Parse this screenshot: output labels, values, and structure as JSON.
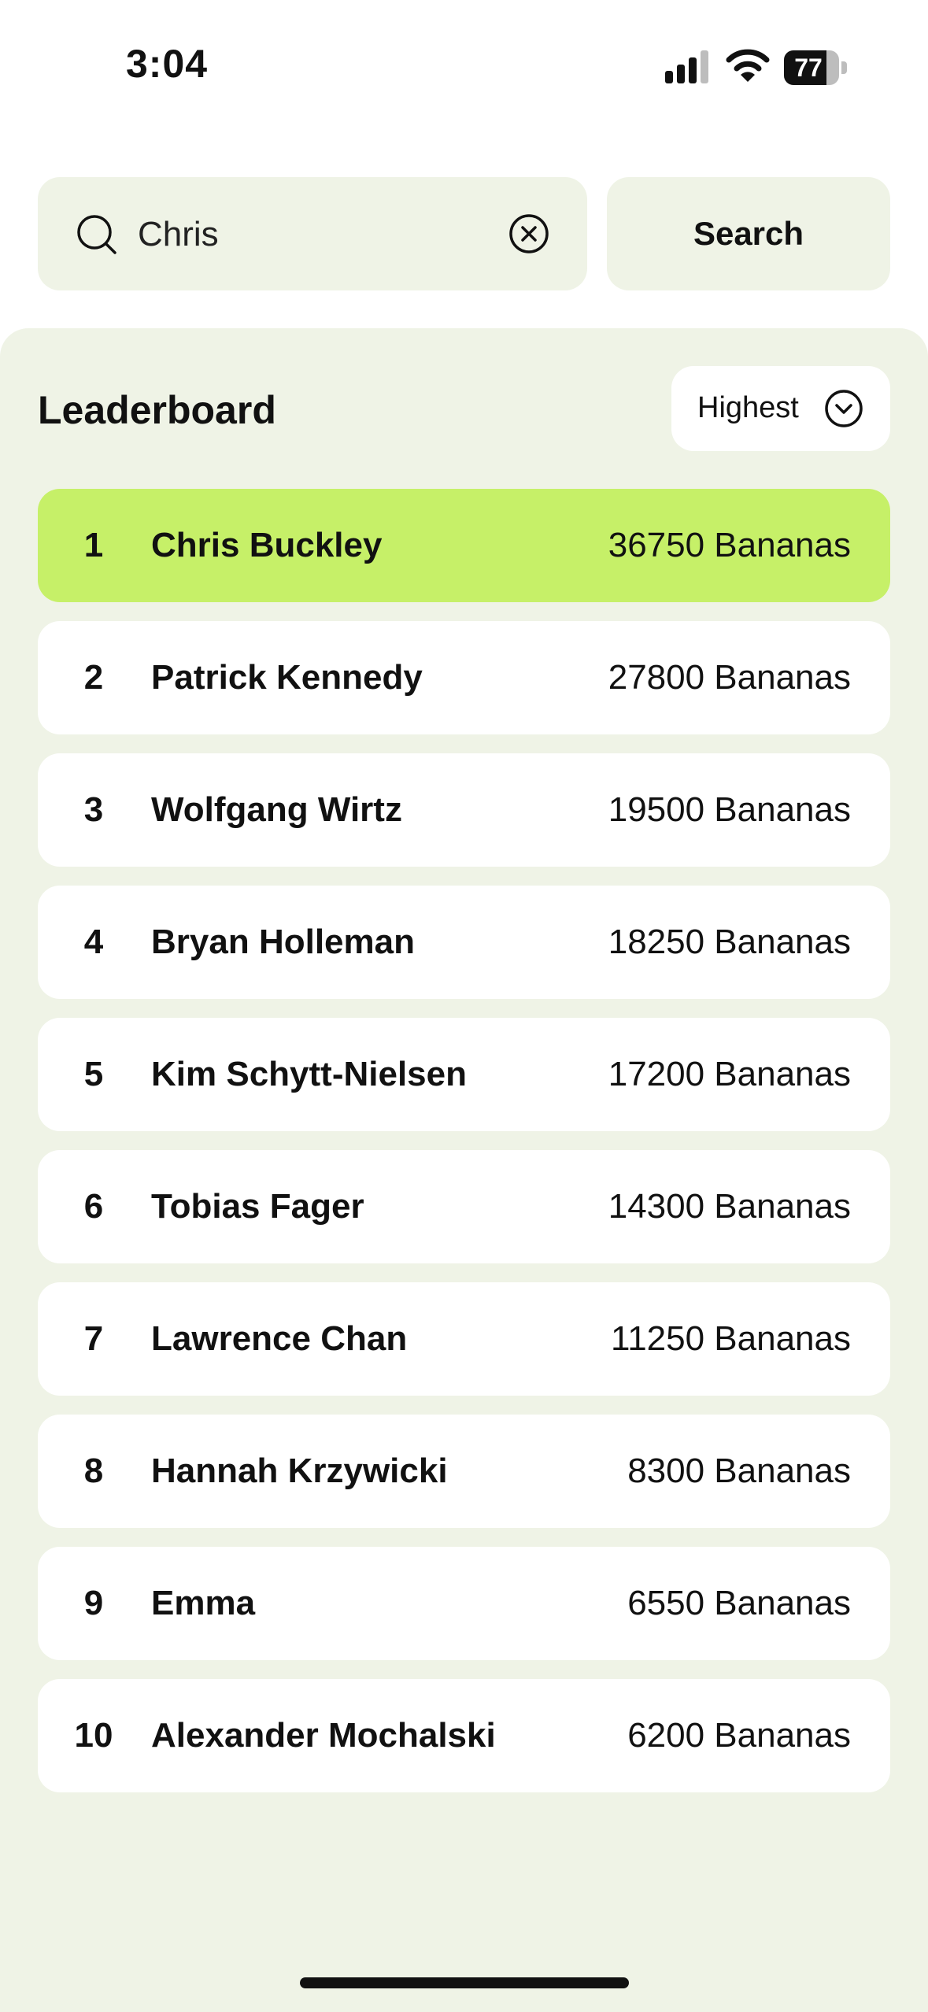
{
  "status_bar": {
    "time": "3:04",
    "battery_percent": "77",
    "battery_level": 0.77,
    "icons": [
      "cellular-signal-icon",
      "wifi-icon",
      "battery-icon"
    ]
  },
  "search": {
    "value": "Chris",
    "button_label": "Search",
    "icons": [
      "search-icon",
      "clear-icon"
    ]
  },
  "leaderboard": {
    "title": "Leaderboard",
    "sort": {
      "selected": "Highest",
      "icon": "chevron-down-icon"
    },
    "rows": [
      {
        "rank": "1",
        "name": "Chris Buckley",
        "score": "36750 Bananas",
        "highlighted": true
      },
      {
        "rank": "2",
        "name": "Patrick Kennedy",
        "score": "27800 Bananas"
      },
      {
        "rank": "3",
        "name": "Wolfgang Wirtz",
        "score": "19500 Bananas"
      },
      {
        "rank": "4",
        "name": "Bryan Holleman",
        "score": "18250 Bananas"
      },
      {
        "rank": "5",
        "name": "Kim Schytt-Nielsen",
        "score": "17200 Bananas"
      },
      {
        "rank": "6",
        "name": "Tobias Fager",
        "score": "14300 Bananas"
      },
      {
        "rank": "7",
        "name": "Lawrence Chan",
        "score": "11250 Bananas"
      },
      {
        "rank": "8",
        "name": "Hannah Krzywicki",
        "score": "8300 Bananas"
      },
      {
        "rank": "9",
        "name": "Emma",
        "score": "6550 Bananas"
      },
      {
        "rank": "10",
        "name": "Alexander Mochalski",
        "score": "6200 Bananas"
      }
    ]
  },
  "colors": {
    "highlight": "#c6f068",
    "panel_background": "#eff3e6",
    "card_background": "#ffffff",
    "text": "#111111"
  }
}
